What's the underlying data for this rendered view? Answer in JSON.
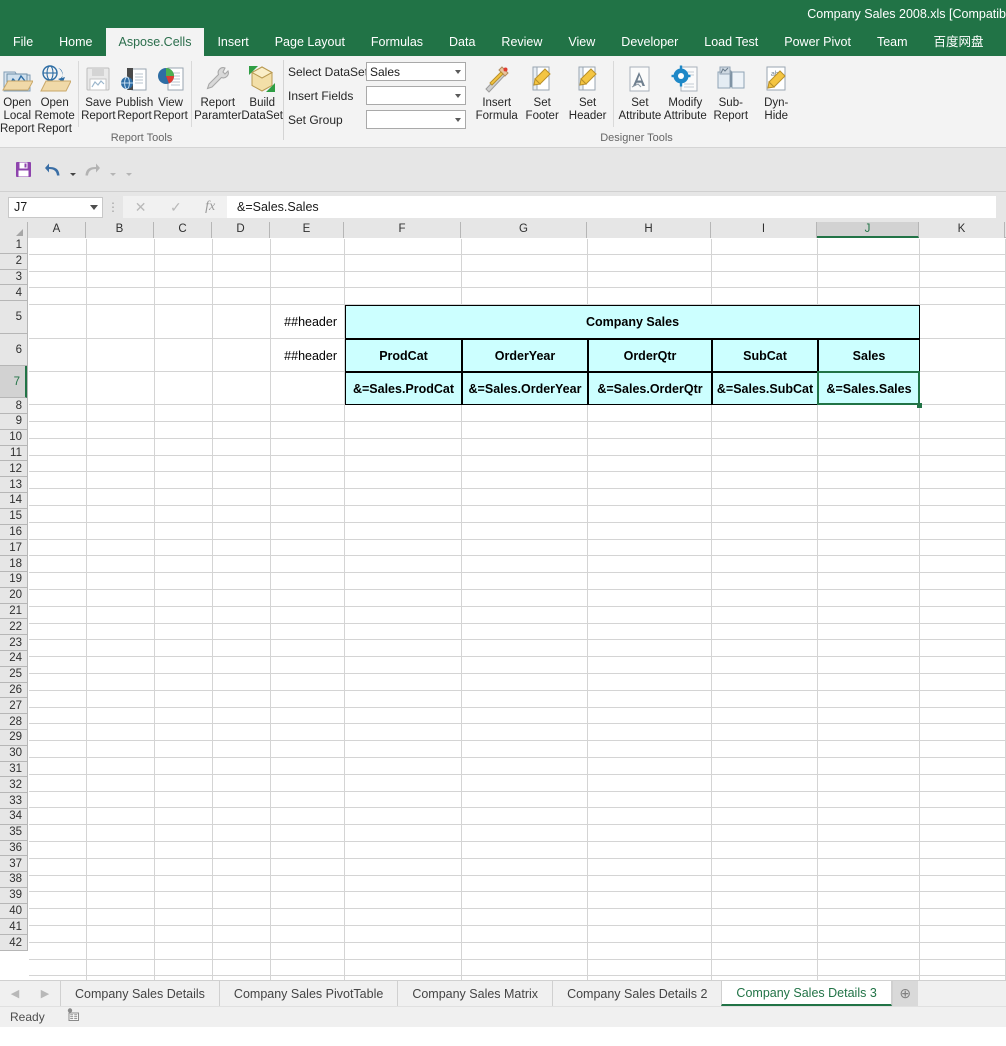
{
  "titlebar": {
    "title": "Company Sales 2008.xls  [Compatib"
  },
  "ribbon_tabs": [
    {
      "label": "File",
      "active": false
    },
    {
      "label": "Home",
      "active": false
    },
    {
      "label": "Aspose.Cells",
      "active": true
    },
    {
      "label": "Insert",
      "active": false
    },
    {
      "label": "Page Layout",
      "active": false
    },
    {
      "label": "Formulas",
      "active": false
    },
    {
      "label": "Data",
      "active": false
    },
    {
      "label": "Review",
      "active": false
    },
    {
      "label": "View",
      "active": false
    },
    {
      "label": "Developer",
      "active": false
    },
    {
      "label": "Load Test",
      "active": false
    },
    {
      "label": "Power Pivot",
      "active": false
    },
    {
      "label": "Team",
      "active": false
    },
    {
      "label": "百度网盘",
      "active": false
    }
  ],
  "ribbon": {
    "report_tools": {
      "group_label": "Report Tools",
      "buttons": [
        {
          "label": "Open Local\nReport",
          "icon": "open-local-report-icon"
        },
        {
          "label": "Open Remote\nReport",
          "icon": "open-remote-report-icon"
        },
        {
          "label": "Save\nReport",
          "icon": "save-report-icon"
        },
        {
          "label": "Publish\nReport",
          "icon": "publish-report-icon"
        },
        {
          "label": "View\nReport",
          "icon": "view-report-icon"
        },
        {
          "label": "Report\nParamter",
          "icon": "report-parameter-icon"
        },
        {
          "label": "Build\nDataSet",
          "icon": "build-dataset-icon"
        }
      ]
    },
    "dataset_group": {
      "rows": [
        {
          "label": "Select DataSet",
          "value": "Sales"
        },
        {
          "label": "Insert Fields",
          "value": ""
        },
        {
          "label": "Set Group",
          "value": ""
        }
      ]
    },
    "designer_tools": {
      "group_label": "Designer Tools",
      "buttons": [
        {
          "label": "Insert\nFormula",
          "icon": "insert-formula-icon"
        },
        {
          "label": "Set\nFooter",
          "icon": "set-footer-icon"
        },
        {
          "label": "Set\nHeader",
          "icon": "set-header-icon"
        },
        {
          "label": "Set\nAttribute",
          "icon": "set-attribute-icon"
        },
        {
          "label": "Modify\nAttribute",
          "icon": "modify-attribute-icon"
        },
        {
          "label": "Sub-\nReport",
          "icon": "sub-report-icon"
        },
        {
          "label": "Dyn-\nHide",
          "icon": "dyn-hide-icon"
        }
      ]
    }
  },
  "quick_access": [
    {
      "name": "save",
      "icon": "save-icon",
      "enabled": true
    },
    {
      "name": "undo",
      "icon": "undo-icon",
      "enabled": true
    },
    {
      "name": "redo",
      "icon": "redo-icon",
      "enabled": false
    },
    {
      "name": "customize",
      "icon": "chevron-down-icon",
      "enabled": true
    }
  ],
  "formula_bar": {
    "name_box": "J7",
    "formula": "&=Sales.Sales",
    "cancel_icon": "cancel-icon",
    "enter_icon": "check-icon",
    "fx_icon": "fx-icon"
  },
  "grid": {
    "columns": [
      "A",
      "B",
      "C",
      "D",
      "E",
      "F",
      "G",
      "H",
      "I",
      "J",
      "K"
    ],
    "selected_column": "J",
    "selected_row": 7,
    "selected_cell": "J7",
    "rows": [
      1,
      2,
      3,
      4,
      5,
      6,
      7,
      8,
      9,
      10,
      11,
      12,
      13,
      14,
      15,
      16,
      17,
      18,
      19,
      20,
      21,
      22,
      23,
      24,
      25,
      26,
      27,
      28,
      29,
      30,
      31,
      32,
      33,
      34,
      35,
      36,
      37,
      38,
      39,
      40,
      41,
      42
    ]
  },
  "sheet_table": {
    "marker_row5": "##header",
    "marker_row6": "##header",
    "title": "Company Sales",
    "headers": [
      "ProdCat",
      "OrderYear",
      "OrderQtr",
      "SubCat",
      "Sales"
    ],
    "data_markers": [
      "&=Sales.ProdCat",
      "&=Sales.OrderYear",
      "&=Sales.OrderQtr",
      "&=Sales.SubCat",
      "&=Sales.Sales"
    ],
    "fill_color": "#ccffff",
    "border_color": "#000000"
  },
  "sheet_tabs": [
    {
      "label": "Company Sales Details",
      "active": false
    },
    {
      "label": "Company Sales PivotTable",
      "active": false
    },
    {
      "label": "Company Sales Matrix",
      "active": false
    },
    {
      "label": "Company Sales Details 2",
      "active": false
    },
    {
      "label": "Company Sales Details 3",
      "active": true
    }
  ],
  "sheet_nav": {
    "prev": "◀",
    "next": "▶",
    "new_sheet": "⊕"
  },
  "status_bar": {
    "status": "Ready",
    "icon": "macro-record-icon"
  },
  "colors": {
    "brand_green": "#217346",
    "tab_active_bg": "#f3f3f3",
    "ribbon_bg": "#f3f3f3"
  }
}
